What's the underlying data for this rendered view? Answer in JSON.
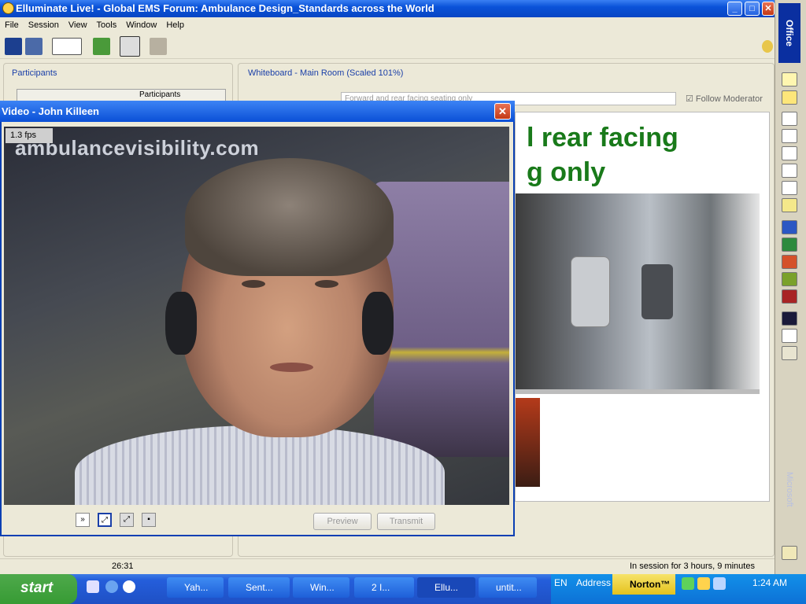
{
  "window": {
    "title": "Elluminate Live! - Global EMS Forum: Ambulance Design_Standards across the World"
  },
  "menu": [
    "File",
    "Session",
    "View",
    "Tools",
    "Window",
    "Help"
  ],
  "participants": {
    "label": "Participants",
    "tab_label": "Participants"
  },
  "whiteboard": {
    "label": "Whiteboard - Main Room (Scaled 101%)",
    "combo_value": "Forward and rear facing seating only",
    "follow_label": "Follow Moderator",
    "slide_title_1": "l rear facing",
    "slide_title_2": "g only"
  },
  "video": {
    "title": "Video - John Killeen",
    "fps": "1.3 fps",
    "watermark": "ambulancevisibility.com",
    "preview_label": "Preview",
    "transmit_label": "Transmit"
  },
  "status": {
    "time": "26:31",
    "session": "In session for 3 hours, 9 minutes"
  },
  "taskbar": {
    "start": "start",
    "tasks": [
      "Yah...",
      "Sent...",
      "Win...",
      "2 I...",
      "Ellu...",
      "untit..."
    ],
    "lang": "EN",
    "address": "Address",
    "norton": "Norton™",
    "clock": "1:24 AM"
  },
  "office_bar": {
    "label": "Office",
    "label2": "Microsoft"
  }
}
